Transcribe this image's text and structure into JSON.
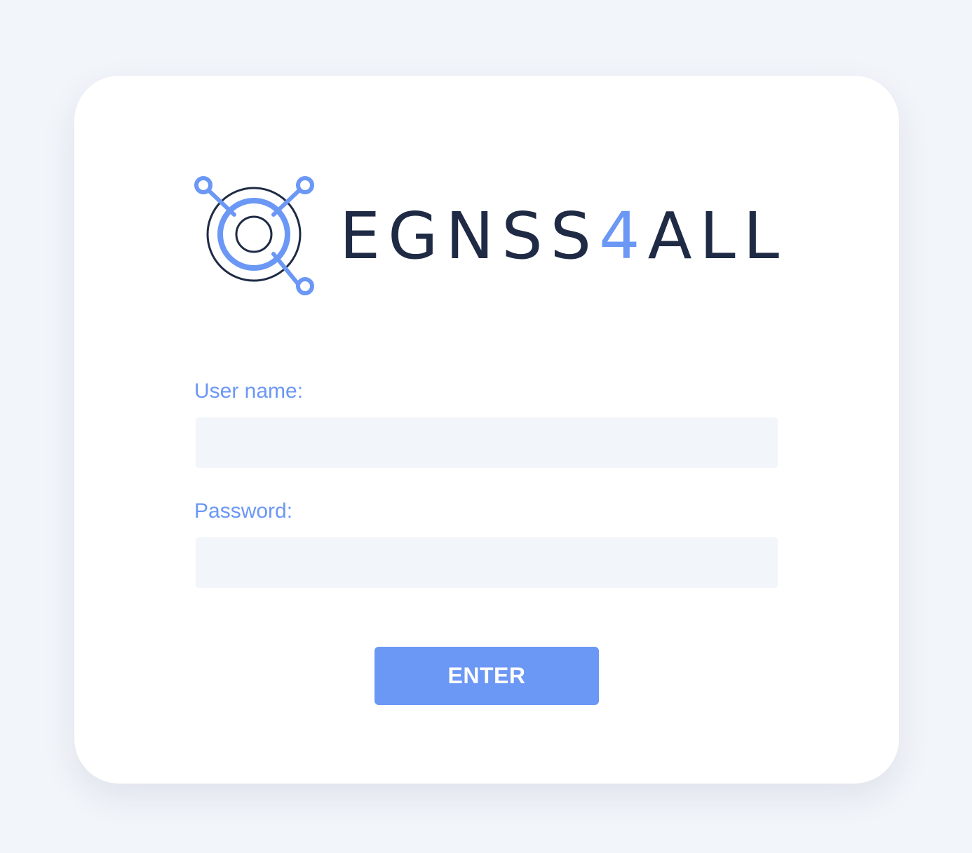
{
  "logo": {
    "text_prefix": "EGNSS",
    "text_accent": "4",
    "text_suffix": "ALL",
    "icon": "satellite-target-icon",
    "colors": {
      "dark": "#1f2b45",
      "accent": "#6b97f5"
    }
  },
  "form": {
    "username": {
      "label": "User name:",
      "value": "",
      "placeholder": ""
    },
    "password": {
      "label": "Password:",
      "value": "",
      "placeholder": ""
    },
    "submit_label": "ENTER"
  },
  "colors": {
    "background": "#f2f5fa",
    "card": "#ffffff",
    "accent": "#6b97f5",
    "input_background": "#f2f5fa"
  }
}
